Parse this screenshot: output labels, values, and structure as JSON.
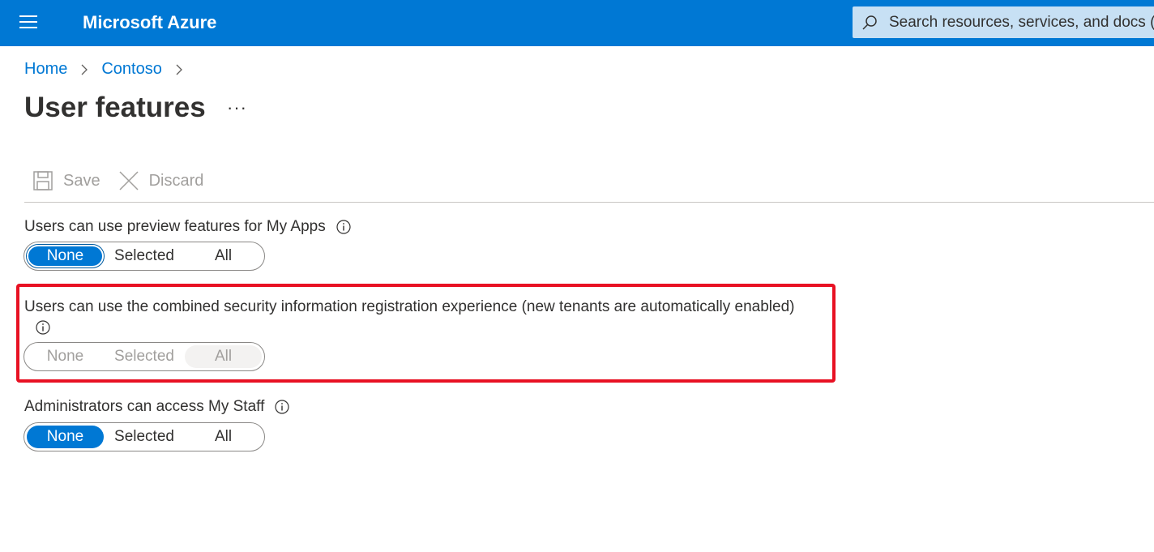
{
  "header": {
    "brand": "Microsoft Azure",
    "search_placeholder": "Search resources, services, and docs (G+/)"
  },
  "breadcrumb": [
    "Home",
    "Contoso"
  ],
  "page": {
    "title": "User features",
    "more_label": "···"
  },
  "toolbar": {
    "save_label": "Save",
    "discard_label": "Discard"
  },
  "settings": [
    {
      "label": "Users can use preview features for My Apps",
      "options": [
        "None",
        "Selected",
        "All"
      ],
      "selected": "None",
      "disabled": false
    },
    {
      "label": "Users can use the combined security information registration experience (new tenants are automatically enabled)",
      "options": [
        "None",
        "Selected",
        "All"
      ],
      "selected": "All",
      "disabled": true
    },
    {
      "label": "Administrators can access My Staff",
      "options": [
        "None",
        "Selected",
        "All"
      ],
      "selected": "None",
      "disabled": false
    }
  ],
  "colors": {
    "accent": "#0078d4",
    "highlight": "#e81123"
  },
  "icons": [
    "hamburger-icon",
    "search-icon",
    "chevron-right-icon",
    "save-icon",
    "close-icon",
    "info-icon"
  ]
}
